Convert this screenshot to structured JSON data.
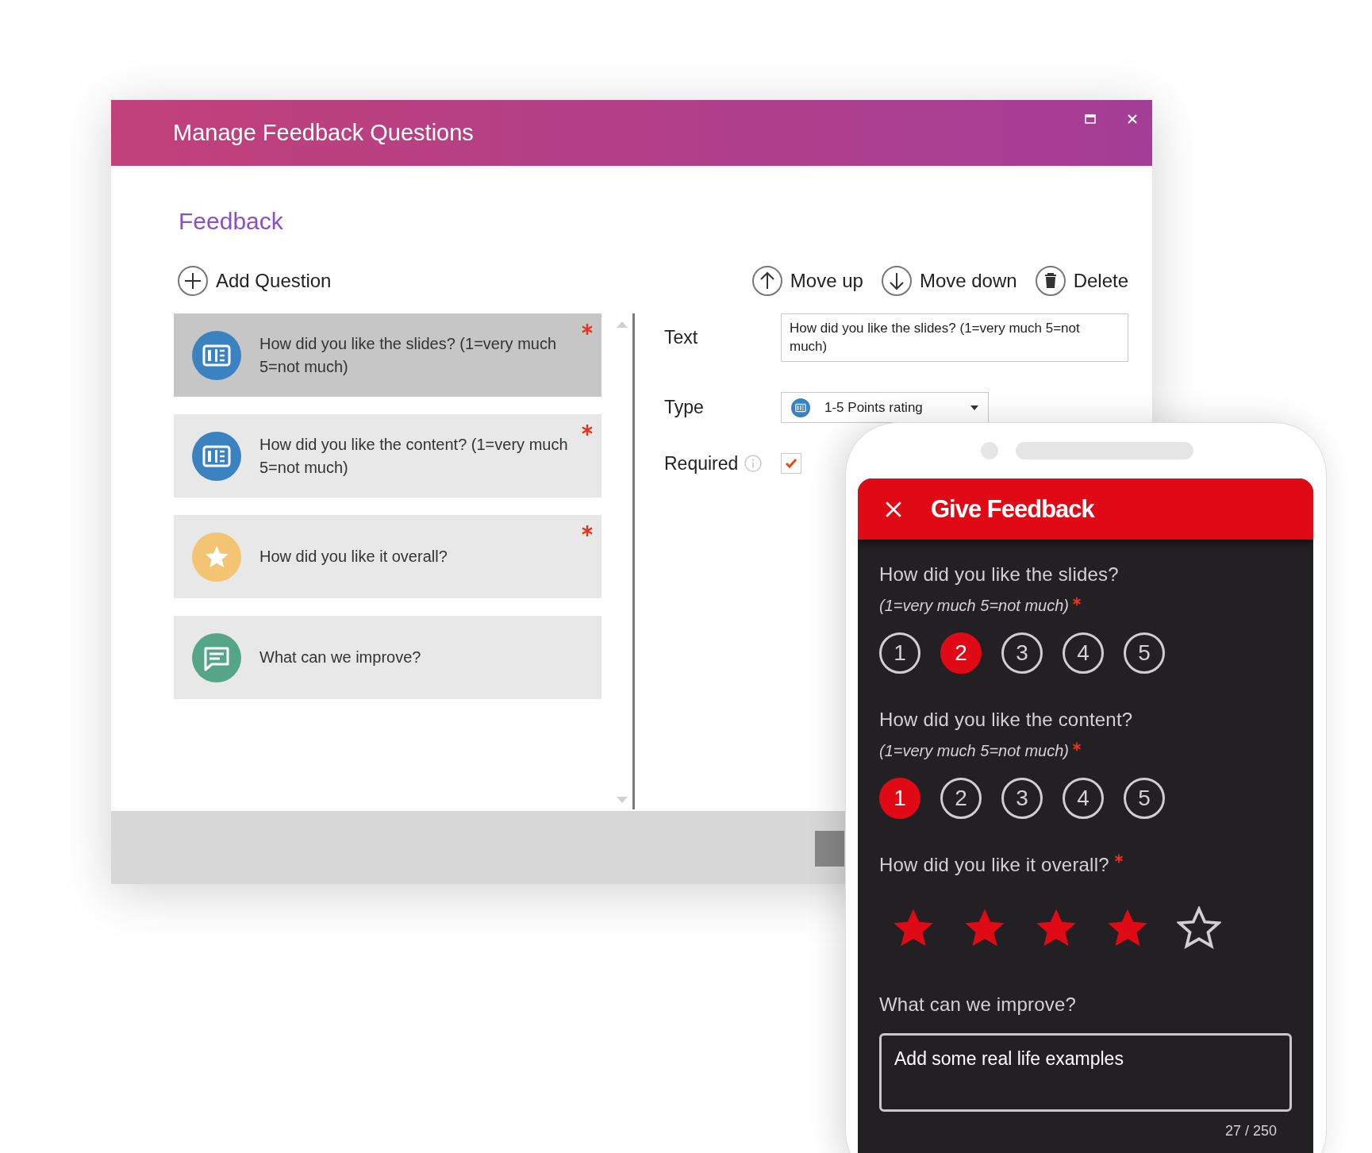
{
  "window": {
    "title": "Manage Feedback Questions"
  },
  "section_title": "Feedback",
  "toolbar": {
    "add_label": "Add Question",
    "actions": [
      {
        "kind": "up",
        "label": "Move up"
      },
      {
        "kind": "down",
        "label": "Move down"
      },
      {
        "kind": "delete",
        "label": "Delete"
      }
    ]
  },
  "questions": [
    {
      "kind": "rating",
      "text": "How did you like the slides? (1=very much 5=not much)",
      "required": true,
      "selected": true
    },
    {
      "kind": "rating",
      "text": "How did you like the content? (1=very much 5=not much)",
      "required": true,
      "selected": false
    },
    {
      "kind": "stars",
      "text": "How did you like it overall?",
      "required": true,
      "selected": false
    },
    {
      "kind": "comment",
      "text": "What can we improve?",
      "required": false,
      "selected": false
    }
  ],
  "editor": {
    "text_label": "Text",
    "text_value": "How did you like the slides? (1=very much 5=not much)",
    "type_label": "Type",
    "type_value": "1-5 Points rating",
    "required_label": "Required",
    "required_checked": true
  },
  "phone": {
    "title": "Give Feedback",
    "questions": [
      {
        "kind": "scale",
        "title": "How did you like the slides?",
        "hint": "(1=very much 5=not much)",
        "required": true,
        "options": [
          {
            "label": "1",
            "selected": false
          },
          {
            "label": "2",
            "selected": true
          },
          {
            "label": "3",
            "selected": false
          },
          {
            "label": "4",
            "selected": false
          },
          {
            "label": "5",
            "selected": false
          }
        ]
      },
      {
        "kind": "scale",
        "title": "How did you like the content?",
        "hint": "(1=very much 5=not much)",
        "required": true,
        "options": [
          {
            "label": "1",
            "selected": true
          },
          {
            "label": "2",
            "selected": false
          },
          {
            "label": "3",
            "selected": false
          },
          {
            "label": "4",
            "selected": false
          },
          {
            "label": "5",
            "selected": false
          }
        ]
      },
      {
        "kind": "stars",
        "title": "How did you like it overall?",
        "required": true,
        "stars": 4
      },
      {
        "kind": "text",
        "title": "What can we improve?",
        "value": "Add some real life examples",
        "counter": "27 / 250"
      }
    ]
  }
}
